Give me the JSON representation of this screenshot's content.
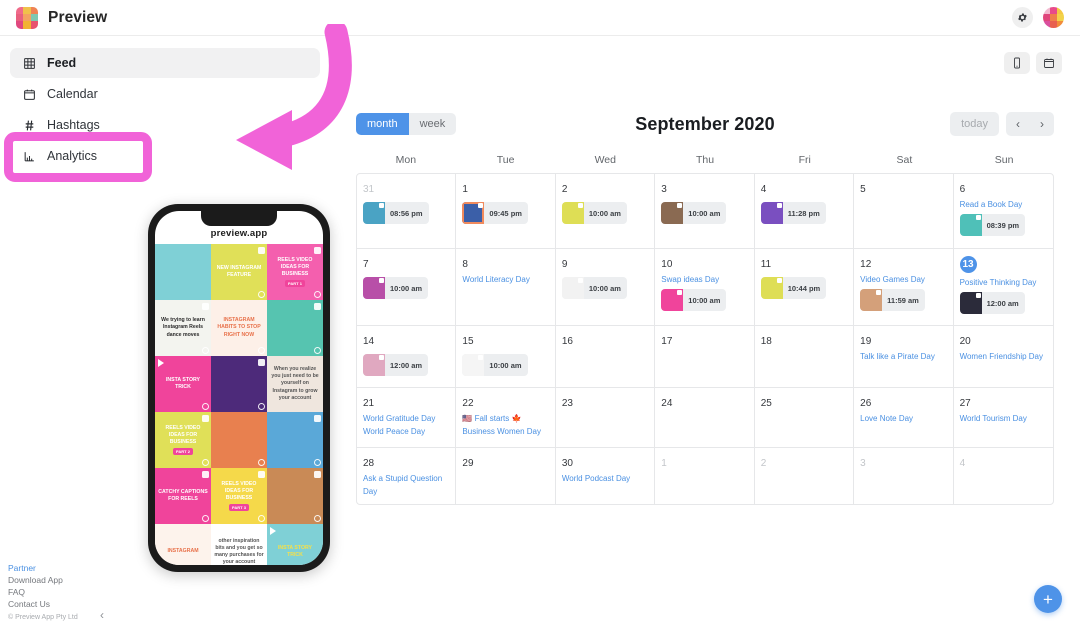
{
  "app": {
    "brand_name": "Preview",
    "logo_colors": [
      "#f06a8a",
      "#f0c14b",
      "#ef8354",
      "#e8607f",
      "#f4a261",
      "#7ec8b0",
      "#e0487f",
      "#f2b233",
      "#e8536f"
    ],
    "avatar_colors": [
      "#f2b8cf",
      "#e84b8a",
      "#f5c842",
      "#e0457b",
      "#f07f4a",
      "#f2d34a",
      "#d94f9e",
      "#e8604f",
      "#f28c3a"
    ]
  },
  "topbar": {
    "gear_icon": "gear-icon",
    "avatar_icon": "avatar"
  },
  "sidebar": {
    "items": [
      {
        "label": "Feed",
        "icon": "grid-icon",
        "active": true
      },
      {
        "label": "Calendar",
        "icon": "calendar-icon",
        "active": false
      },
      {
        "label": "Hashtags",
        "icon": "hashtag-icon",
        "active": false
      },
      {
        "label": "Analytics",
        "icon": "bar-chart-icon",
        "active": false
      }
    ],
    "highlight_color": "#f163d8"
  },
  "phone": {
    "title": "preview.app",
    "tiles": [
      {
        "bg": "#7fd0d6",
        "text": "",
        "kind": "photo-phone",
        "doc": false,
        "clock": false
      },
      {
        "bg": "#e0e058",
        "text": "NEW INSTAGRAM FEATURE",
        "color": "#ffffff",
        "doc": true,
        "clock": true
      },
      {
        "bg": "#f45fae",
        "text": "REELS VIDEO IDEAS FOR BUSINESS",
        "color": "#ffffff",
        "pill": "PART 1",
        "doc": true,
        "clock": true
      },
      {
        "bg": "#f3f4ef",
        "text": "We trying to learn Instagram Reels dance moves",
        "color": "#2b2b2b",
        "doc": true,
        "clock": true
      },
      {
        "bg": "#fdf0e8",
        "text": "INSTAGRAM HABITS TO STOP RIGHT NOW",
        "color": "#e8714a",
        "doc": false,
        "clock": true
      },
      {
        "bg": "#56c4b0",
        "text": "",
        "kind": "photo-rainbow",
        "doc": true,
        "clock": true
      },
      {
        "bg": "#f0449b",
        "text": "INSTA STORY TRICK",
        "color": "#ffffff",
        "play": true,
        "clock": true
      },
      {
        "bg": "#4d2a7a",
        "text": "",
        "kind": "photo-purple",
        "doc": true,
        "clock": true
      },
      {
        "bg": "#efe6de",
        "text": "When you realize you just need to be yourself on Instagram to grow your account",
        "color": "#555",
        "kind": "photo-meme",
        "doc": false,
        "clock": false
      },
      {
        "bg": "#e0e058",
        "text": "REELS VIDEO IDEAS FOR BUSINESS",
        "color": "#ffffff",
        "pill": "PART 2",
        "doc": true,
        "clock": true
      },
      {
        "bg": "#e8804f",
        "text": "",
        "kind": "photo-blue",
        "doc": false,
        "clock": true
      },
      {
        "bg": "#5aa8d8",
        "text": "",
        "kind": "photo-field",
        "doc": true,
        "clock": true
      },
      {
        "bg": "#f0449b",
        "text": "CATCHY CAPTIONS FOR REELS",
        "color": "#ffffff",
        "doc": true,
        "clock": true
      },
      {
        "bg": "#f5d94a",
        "text": "REELS VIDEO IDEAS FOR BUSINESS",
        "color": "#ffffff",
        "pill": "PART 3",
        "doc": true,
        "clock": true
      },
      {
        "bg": "#c98a56",
        "text": "",
        "kind": "photo-sunset",
        "doc": true,
        "clock": true
      },
      {
        "bg": "#fdf3ec",
        "text": "INSTAGRAM",
        "color": "#e8714a",
        "kind": "doc-list",
        "doc": false,
        "clock": true
      },
      {
        "bg": "#ffffff",
        "text": "other inspiration bits and you get so many purchases for your account",
        "color": "#555",
        "kind": "photo-yoda",
        "doc": true,
        "clock": true
      },
      {
        "bg": "#7fd0d6",
        "text": "INSTA STORY TRICK",
        "color": "#f5e04a",
        "play": true,
        "clock": true
      }
    ]
  },
  "footer": {
    "links": [
      "Partner",
      "Download App",
      "FAQ",
      "Contact Us"
    ],
    "copyright": "© Preview App Pty Ltd",
    "collapse_icon": "chevron-left-icon"
  },
  "main_toolbar": {
    "buttons": [
      {
        "name": "phone-view-button",
        "icon": "phone-icon"
      },
      {
        "name": "calendar-view-button",
        "icon": "calendar-icon"
      }
    ]
  },
  "calendar": {
    "views": [
      {
        "label": "month",
        "selected": true
      },
      {
        "label": "week",
        "selected": false
      }
    ],
    "title": "September 2020",
    "today_label": "today",
    "prev_icon": "chevron-left-icon",
    "next_icon": "chevron-right-icon",
    "day_headers": [
      "Mon",
      "Tue",
      "Wed",
      "Thu",
      "Fri",
      "Sat",
      "Sun"
    ],
    "weeks": [
      [
        {
          "day": "31",
          "other": true,
          "holidays": [],
          "events": [
            {
              "time": "08:56 pm",
              "thumb": "#4aa3c4"
            }
          ]
        },
        {
          "day": "1",
          "other": false,
          "holidays": [],
          "events": [
            {
              "time": "09:45 pm",
              "thumb": "#3b5fa8",
              "border": "#f08a5d"
            }
          ]
        },
        {
          "day": "2",
          "other": false,
          "holidays": [],
          "events": [
            {
              "time": "10:00 am",
              "thumb": "#dede55"
            }
          ]
        },
        {
          "day": "3",
          "other": false,
          "holidays": [],
          "events": [
            {
              "time": "10:00 am",
              "thumb": "#8a6a52"
            }
          ]
        },
        {
          "day": "4",
          "other": false,
          "holidays": [],
          "events": [
            {
              "time": "11:28 pm",
              "thumb": "#7a4fc0"
            }
          ]
        },
        {
          "day": "5",
          "other": false,
          "holidays": [],
          "events": []
        },
        {
          "day": "6",
          "other": false,
          "holidays": [
            "Read a Book Day"
          ],
          "events": [
            {
              "time": "08:39 pm",
              "thumb": "#4fc0b8"
            }
          ]
        }
      ],
      [
        {
          "day": "7",
          "other": false,
          "holidays": [],
          "events": [
            {
              "time": "10:00 am",
              "thumb": "#b84fa8"
            }
          ]
        },
        {
          "day": "8",
          "other": false,
          "holidays": [
            "World Literacy Day"
          ],
          "events": []
        },
        {
          "day": "9",
          "other": false,
          "holidays": [],
          "events": [
            {
              "time": "10:00 am",
              "thumb": "#f2f2f2"
            }
          ]
        },
        {
          "day": "10",
          "other": false,
          "holidays": [
            "Swap ideas Day"
          ],
          "events": [
            {
              "time": "10:00 am",
              "thumb": "#f0449b"
            }
          ]
        },
        {
          "day": "11",
          "other": false,
          "holidays": [],
          "events": [
            {
              "time": "10:44 pm",
              "thumb": "#dede55"
            }
          ]
        },
        {
          "day": "12",
          "other": false,
          "holidays": [
            "Video Games Day"
          ],
          "events": [
            {
              "time": "11:59 am",
              "thumb": "#d4a07a"
            }
          ]
        },
        {
          "day": "13",
          "other": false,
          "today": true,
          "holidays": [
            "Positive Thinking Day"
          ],
          "events": [
            {
              "time": "12:00 am",
              "thumb": "#2b2b3a"
            }
          ]
        }
      ],
      [
        {
          "day": "14",
          "other": false,
          "holidays": [],
          "events": [
            {
              "time": "12:00 am",
              "thumb": "#e0a8c0"
            }
          ]
        },
        {
          "day": "15",
          "other": false,
          "holidays": [],
          "events": [
            {
              "time": "10:00 am",
              "thumb": "#f5f5f5"
            }
          ]
        },
        {
          "day": "16",
          "other": false,
          "holidays": [],
          "events": []
        },
        {
          "day": "17",
          "other": false,
          "holidays": [],
          "events": []
        },
        {
          "day": "18",
          "other": false,
          "holidays": [],
          "events": []
        },
        {
          "day": "19",
          "other": false,
          "holidays": [
            "Talk like a Pirate Day"
          ],
          "events": []
        },
        {
          "day": "20",
          "other": false,
          "holidays": [
            "Women Friendship Day"
          ],
          "events": []
        }
      ],
      [
        {
          "day": "21",
          "other": false,
          "holidays": [
            "World Gratitude Day",
            "World Peace Day"
          ],
          "events": []
        },
        {
          "day": "22",
          "other": false,
          "holidays": [
            "🇺🇸 Fall starts 🍁",
            "Business Women Day"
          ],
          "events": []
        },
        {
          "day": "23",
          "other": false,
          "holidays": [],
          "events": []
        },
        {
          "day": "24",
          "other": false,
          "holidays": [],
          "events": []
        },
        {
          "day": "25",
          "other": false,
          "holidays": [],
          "events": []
        },
        {
          "day": "26",
          "other": false,
          "holidays": [
            "Love Note Day"
          ],
          "events": []
        },
        {
          "day": "27",
          "other": false,
          "holidays": [
            "World Tourism Day"
          ],
          "events": []
        }
      ],
      [
        {
          "day": "28",
          "other": false,
          "holidays": [
            "Ask a Stupid Question Day"
          ],
          "events": []
        },
        {
          "day": "29",
          "other": false,
          "holidays": [],
          "events": []
        },
        {
          "day": "30",
          "other": false,
          "holidays": [
            "World Podcast Day"
          ],
          "events": []
        },
        {
          "day": "1",
          "other": true,
          "holidays": [],
          "events": []
        },
        {
          "day": "2",
          "other": true,
          "holidays": [],
          "events": []
        },
        {
          "day": "3",
          "other": true,
          "holidays": [],
          "events": []
        },
        {
          "day": "4",
          "other": true,
          "holidays": [],
          "events": []
        }
      ]
    ],
    "accent_color": "#4e93e8",
    "holiday_color": "#4a90e2",
    "fab_label": "+"
  }
}
